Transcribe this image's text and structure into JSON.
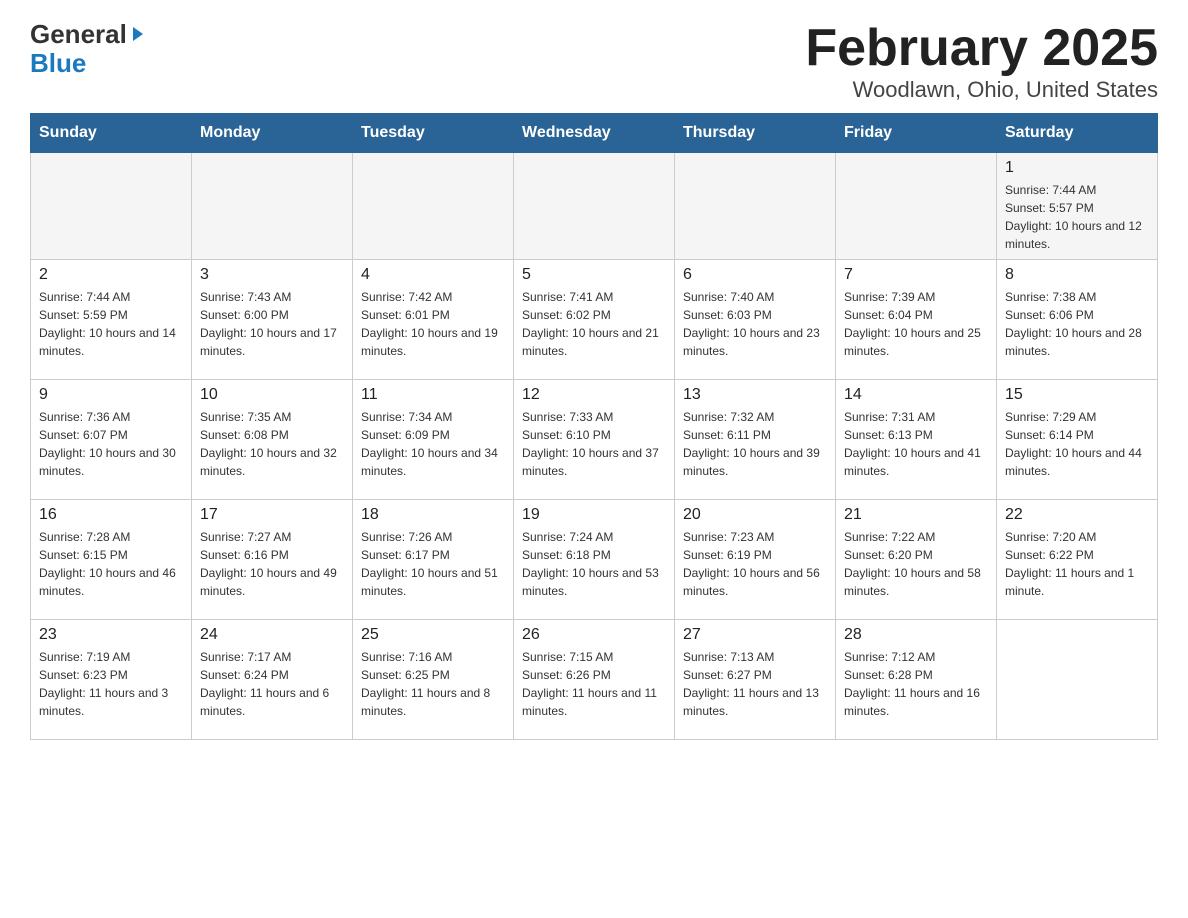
{
  "header": {
    "logo_general": "General",
    "logo_blue": "Blue",
    "title": "February 2025",
    "subtitle": "Woodlawn, Ohio, United States"
  },
  "days_of_week": [
    "Sunday",
    "Monday",
    "Tuesday",
    "Wednesday",
    "Thursday",
    "Friday",
    "Saturday"
  ],
  "weeks": [
    [
      {
        "day": "",
        "info": ""
      },
      {
        "day": "",
        "info": ""
      },
      {
        "day": "",
        "info": ""
      },
      {
        "day": "",
        "info": ""
      },
      {
        "day": "",
        "info": ""
      },
      {
        "day": "",
        "info": ""
      },
      {
        "day": "1",
        "info": "Sunrise: 7:44 AM\nSunset: 5:57 PM\nDaylight: 10 hours and 12 minutes."
      }
    ],
    [
      {
        "day": "2",
        "info": "Sunrise: 7:44 AM\nSunset: 5:59 PM\nDaylight: 10 hours and 14 minutes."
      },
      {
        "day": "3",
        "info": "Sunrise: 7:43 AM\nSunset: 6:00 PM\nDaylight: 10 hours and 17 minutes."
      },
      {
        "day": "4",
        "info": "Sunrise: 7:42 AM\nSunset: 6:01 PM\nDaylight: 10 hours and 19 minutes."
      },
      {
        "day": "5",
        "info": "Sunrise: 7:41 AM\nSunset: 6:02 PM\nDaylight: 10 hours and 21 minutes."
      },
      {
        "day": "6",
        "info": "Sunrise: 7:40 AM\nSunset: 6:03 PM\nDaylight: 10 hours and 23 minutes."
      },
      {
        "day": "7",
        "info": "Sunrise: 7:39 AM\nSunset: 6:04 PM\nDaylight: 10 hours and 25 minutes."
      },
      {
        "day": "8",
        "info": "Sunrise: 7:38 AM\nSunset: 6:06 PM\nDaylight: 10 hours and 28 minutes."
      }
    ],
    [
      {
        "day": "9",
        "info": "Sunrise: 7:36 AM\nSunset: 6:07 PM\nDaylight: 10 hours and 30 minutes."
      },
      {
        "day": "10",
        "info": "Sunrise: 7:35 AM\nSunset: 6:08 PM\nDaylight: 10 hours and 32 minutes."
      },
      {
        "day": "11",
        "info": "Sunrise: 7:34 AM\nSunset: 6:09 PM\nDaylight: 10 hours and 34 minutes."
      },
      {
        "day": "12",
        "info": "Sunrise: 7:33 AM\nSunset: 6:10 PM\nDaylight: 10 hours and 37 minutes."
      },
      {
        "day": "13",
        "info": "Sunrise: 7:32 AM\nSunset: 6:11 PM\nDaylight: 10 hours and 39 minutes."
      },
      {
        "day": "14",
        "info": "Sunrise: 7:31 AM\nSunset: 6:13 PM\nDaylight: 10 hours and 41 minutes."
      },
      {
        "day": "15",
        "info": "Sunrise: 7:29 AM\nSunset: 6:14 PM\nDaylight: 10 hours and 44 minutes."
      }
    ],
    [
      {
        "day": "16",
        "info": "Sunrise: 7:28 AM\nSunset: 6:15 PM\nDaylight: 10 hours and 46 minutes."
      },
      {
        "day": "17",
        "info": "Sunrise: 7:27 AM\nSunset: 6:16 PM\nDaylight: 10 hours and 49 minutes."
      },
      {
        "day": "18",
        "info": "Sunrise: 7:26 AM\nSunset: 6:17 PM\nDaylight: 10 hours and 51 minutes."
      },
      {
        "day": "19",
        "info": "Sunrise: 7:24 AM\nSunset: 6:18 PM\nDaylight: 10 hours and 53 minutes."
      },
      {
        "day": "20",
        "info": "Sunrise: 7:23 AM\nSunset: 6:19 PM\nDaylight: 10 hours and 56 minutes."
      },
      {
        "day": "21",
        "info": "Sunrise: 7:22 AM\nSunset: 6:20 PM\nDaylight: 10 hours and 58 minutes."
      },
      {
        "day": "22",
        "info": "Sunrise: 7:20 AM\nSunset: 6:22 PM\nDaylight: 11 hours and 1 minute."
      }
    ],
    [
      {
        "day": "23",
        "info": "Sunrise: 7:19 AM\nSunset: 6:23 PM\nDaylight: 11 hours and 3 minutes."
      },
      {
        "day": "24",
        "info": "Sunrise: 7:17 AM\nSunset: 6:24 PM\nDaylight: 11 hours and 6 minutes."
      },
      {
        "day": "25",
        "info": "Sunrise: 7:16 AM\nSunset: 6:25 PM\nDaylight: 11 hours and 8 minutes."
      },
      {
        "day": "26",
        "info": "Sunrise: 7:15 AM\nSunset: 6:26 PM\nDaylight: 11 hours and 11 minutes."
      },
      {
        "day": "27",
        "info": "Sunrise: 7:13 AM\nSunset: 6:27 PM\nDaylight: 11 hours and 13 minutes."
      },
      {
        "day": "28",
        "info": "Sunrise: 7:12 AM\nSunset: 6:28 PM\nDaylight: 11 hours and 16 minutes."
      },
      {
        "day": "",
        "info": ""
      }
    ]
  ]
}
